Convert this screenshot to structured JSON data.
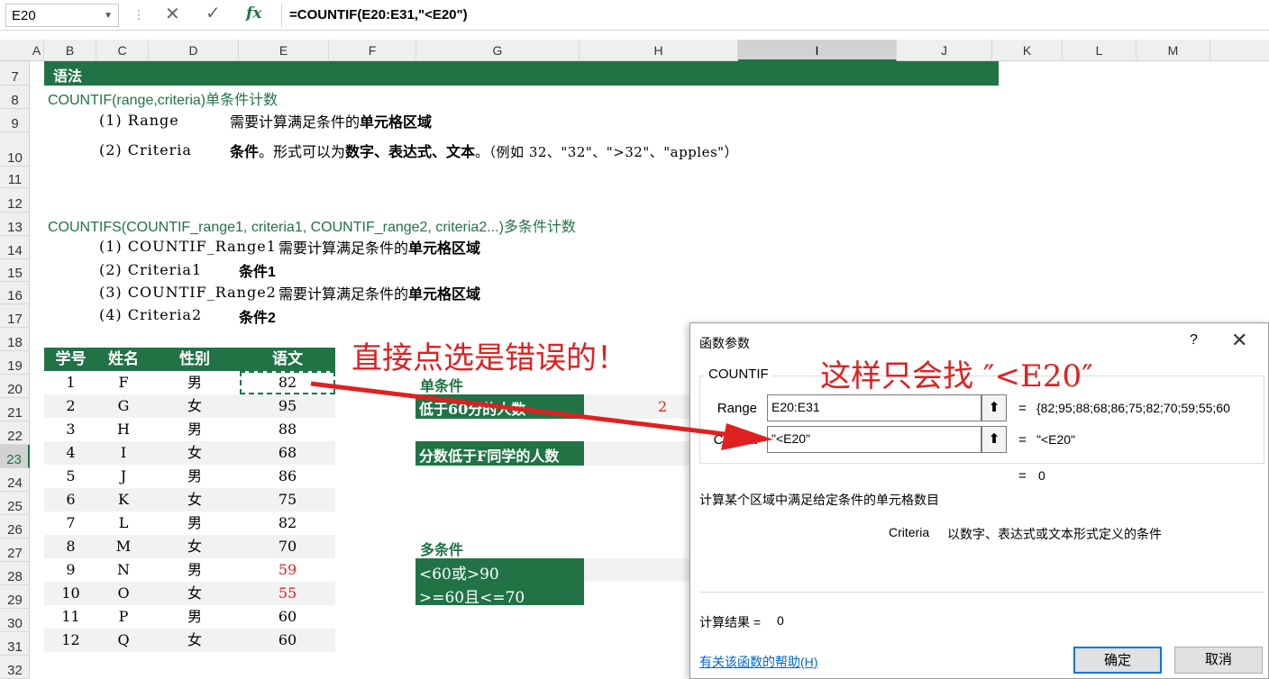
{
  "formula_bar": {
    "name_box": "E20",
    "cancel_icon": "✕",
    "enter_icon": "✓",
    "fx_label": "fx",
    "formula": "=COUNTIF(E20:E31,\"<E20\")"
  },
  "columns": [
    "A",
    "B",
    "C",
    "D",
    "E",
    "F",
    "G",
    "H",
    "I",
    "J",
    "K",
    "L",
    "M"
  ],
  "rows": [
    "7",
    "8",
    "9",
    "10",
    "11",
    "12",
    "13",
    "14",
    "15",
    "16",
    "17",
    "18",
    "19",
    "20",
    "21",
    "22",
    "23",
    "24",
    "25",
    "26",
    "27",
    "28",
    "29",
    "30",
    "31",
    "32"
  ],
  "sheet": {
    "syntax_header": "语法",
    "countif_sig": "COUNTIF(range,criteria)单条件计数",
    "r9_param": "(1) Range",
    "r9_desc_plain": "需要计算满足条件的",
    "r9_desc_bold": "单元格区域",
    "r10_param": "(2) Criteria",
    "r10_desc_a": "条件",
    "r10_desc_b": "。形式可以为",
    "r10_desc_c": "数字、表达式、文本",
    "r10_desc_d": "。（例如 32、\"32\"、\">32\"、\"apples\"）",
    "countifs_sig": "COUNTIFS(COUNTIF_range1, criteria1, COUNTIF_range2, criteria2...)多条件计数",
    "r14_param": "(1) COUNTIF_Range1",
    "r14_desc_plain": "需要计算满足条件的",
    "r14_desc_bold": "单元格区域",
    "r15_param": "(2) Criteria1",
    "r15_desc": "条件1",
    "r16_param": "(3) COUNTIF_Range2",
    "r16_desc_plain": "需要计算满足条件的",
    "r16_desc_bold": "单元格区域",
    "r17_param": "(4) Criteria2",
    "r17_desc": "条件2"
  },
  "table": {
    "headers": [
      "学号",
      "姓名",
      "性别",
      "语文"
    ],
    "rows": [
      {
        "id": "1",
        "name": "F",
        "gender": "男",
        "score": "82"
      },
      {
        "id": "2",
        "name": "G",
        "gender": "女",
        "score": "95"
      },
      {
        "id": "3",
        "name": "H",
        "gender": "男",
        "score": "88"
      },
      {
        "id": "4",
        "name": "I",
        "gender": "女",
        "score": "68"
      },
      {
        "id": "5",
        "name": "J",
        "gender": "男",
        "score": "86"
      },
      {
        "id": "6",
        "name": "K",
        "gender": "女",
        "score": "75"
      },
      {
        "id": "7",
        "name": "L",
        "gender": "男",
        "score": "82"
      },
      {
        "id": "8",
        "name": "M",
        "gender": "女",
        "score": "70"
      },
      {
        "id": "9",
        "name": "N",
        "gender": "男",
        "score": "59",
        "red": true
      },
      {
        "id": "10",
        "name": "O",
        "gender": "女",
        "score": "55",
        "red": true
      },
      {
        "id": "11",
        "name": "P",
        "gender": "男",
        "score": "60"
      },
      {
        "id": "12",
        "name": "Q",
        "gender": "女",
        "score": "60"
      }
    ]
  },
  "conditions": {
    "single_header": "单条件",
    "below60_label": "低于60分的人数",
    "below60_value": "2",
    "belowF_label": "分数低于F同学的人数",
    "multi_header": "多条件",
    "multi_1": "<60或>90",
    "multi_2": ">=60且<=70"
  },
  "annotations": {
    "wrong_click": "直接点选是错误的！",
    "only_finds": "这样只会找 ″<E20″"
  },
  "dialog": {
    "title": "函数参数",
    "help_icon": "?",
    "close_icon": "✕",
    "function_name": "COUNTIF",
    "range_label": "Range",
    "range_value": "E20:E31",
    "range_result": "{82;95;88;68;86;75;82;70;59;55;60",
    "criteria_label": "Criteria",
    "criteria_value": "\"<E20\"",
    "criteria_result": "\"<E20\"",
    "collapse_icon": "⬆",
    "equals": "=",
    "overall_result": "0",
    "description": "计算某个区域中满足给定条件的单元格数目",
    "param_name": "Criteria",
    "param_desc": "以数字、表达式或文本形式定义的条件",
    "calc_result_label": "计算结果 =",
    "calc_result_value": "0",
    "help_link": "有关该函数的帮助(H)",
    "ok_button": "确定",
    "cancel_button": "取消"
  }
}
